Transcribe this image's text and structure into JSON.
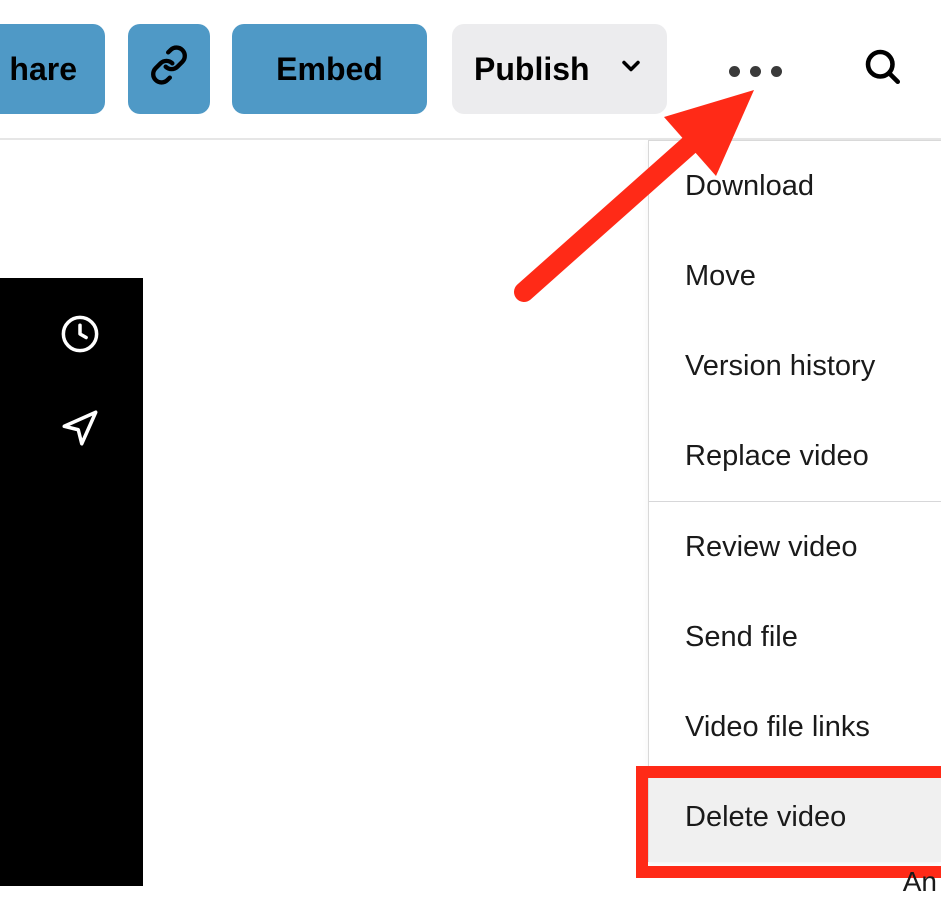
{
  "toolbar": {
    "share_label": "hare",
    "embed_label": "Embed",
    "publish_label": "Publish"
  },
  "menu": {
    "group1": {
      "download": "Download",
      "move": "Move",
      "version_history": "Version history",
      "replace_video": "Replace video"
    },
    "group2": {
      "review_video": "Review video",
      "send_file": "Send file",
      "video_file_links": "Video file links",
      "delete_video": "Delete video"
    }
  },
  "bottom_cut_text": "An"
}
